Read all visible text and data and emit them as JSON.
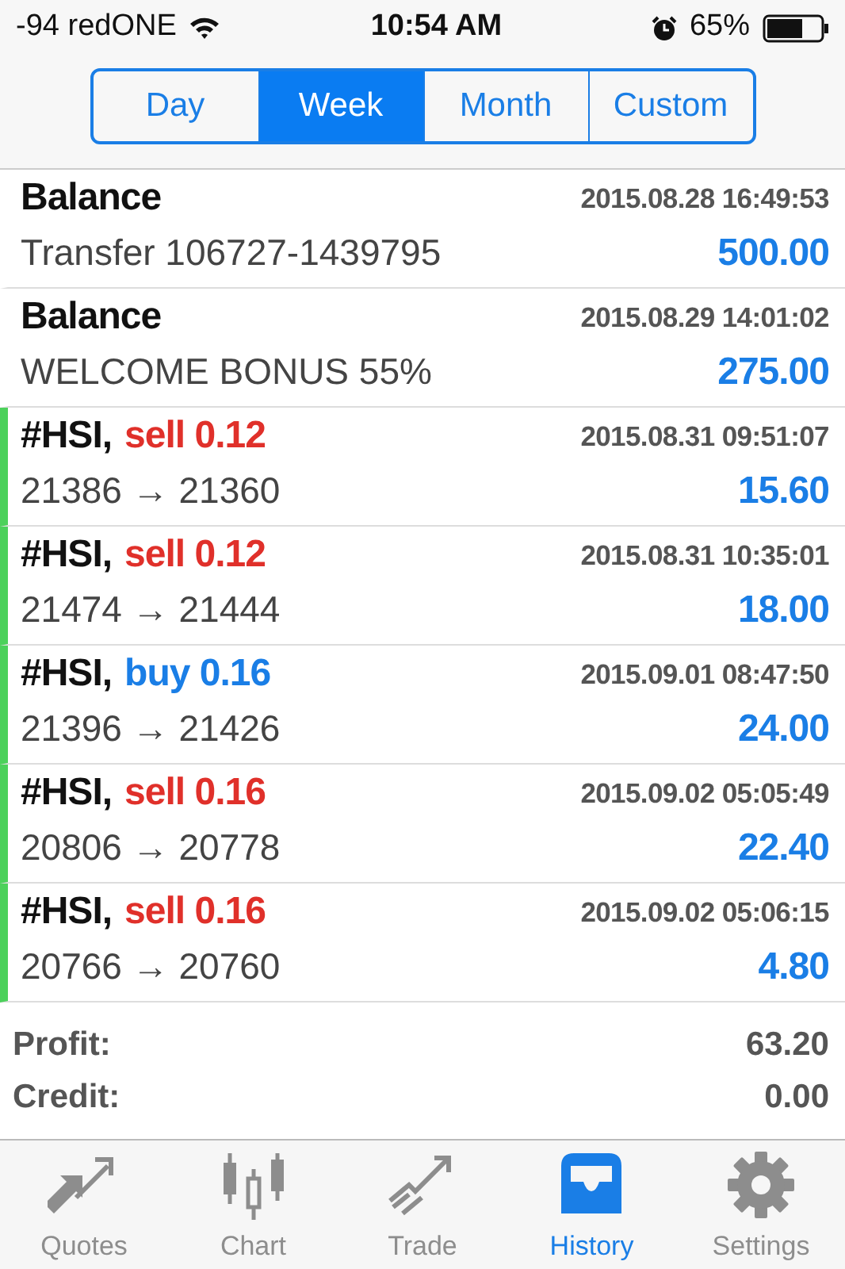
{
  "status_bar": {
    "carrier": "-94 redONE",
    "time": "10:54 AM",
    "battery": "65%"
  },
  "periods": [
    {
      "label": "Day",
      "selected": false
    },
    {
      "label": "Week",
      "selected": true
    },
    {
      "label": "Month",
      "selected": false
    },
    {
      "label": "Custom",
      "selected": false
    }
  ],
  "records": [
    {
      "kind": "balance",
      "title": "Balance",
      "time": "2015.08.28 16:49:53",
      "detail": "Transfer 106727-1439795",
      "amount": "500.00"
    },
    {
      "kind": "balance",
      "title": "Balance",
      "time": "2015.08.29 14:01:02",
      "detail": "WELCOME BONUS 55%",
      "amount": "275.00"
    },
    {
      "kind": "sell",
      "title": "#HSI,",
      "side": "sell",
      "volume": "0.12",
      "time": "2015.08.31 09:51:07",
      "detail": "21386 → 21360",
      "amount": "15.60"
    },
    {
      "kind": "sell",
      "title": "#HSI,",
      "side": "sell",
      "volume": "0.12",
      "time": "2015.08.31 10:35:01",
      "detail": "21474 → 21444",
      "amount": "18.00"
    },
    {
      "kind": "buy",
      "title": "#HSI,",
      "side": "buy",
      "volume": "0.16",
      "time": "2015.09.01 08:47:50",
      "detail": "21396 → 21426",
      "amount": "24.00"
    },
    {
      "kind": "sell",
      "title": "#HSI,",
      "side": "sell",
      "volume": "0.16",
      "time": "2015.09.02 05:05:49",
      "detail": "20806 → 20778",
      "amount": "22.40"
    },
    {
      "kind": "sell",
      "title": "#HSI,",
      "side": "sell",
      "volume": "0.16",
      "time": "2015.09.02 05:06:15",
      "detail": "20766 → 20760",
      "amount": "4.80"
    }
  ],
  "summary": [
    {
      "label": "Profit:",
      "value": "63.20"
    },
    {
      "label": "Credit:",
      "value": "0.00"
    }
  ],
  "tab_bar": [
    {
      "label": "Quotes",
      "selected": false
    },
    {
      "label": "Chart",
      "selected": false
    },
    {
      "label": "Trade",
      "selected": false
    },
    {
      "label": "History",
      "selected": true
    },
    {
      "label": "Settings",
      "selected": false
    }
  ]
}
